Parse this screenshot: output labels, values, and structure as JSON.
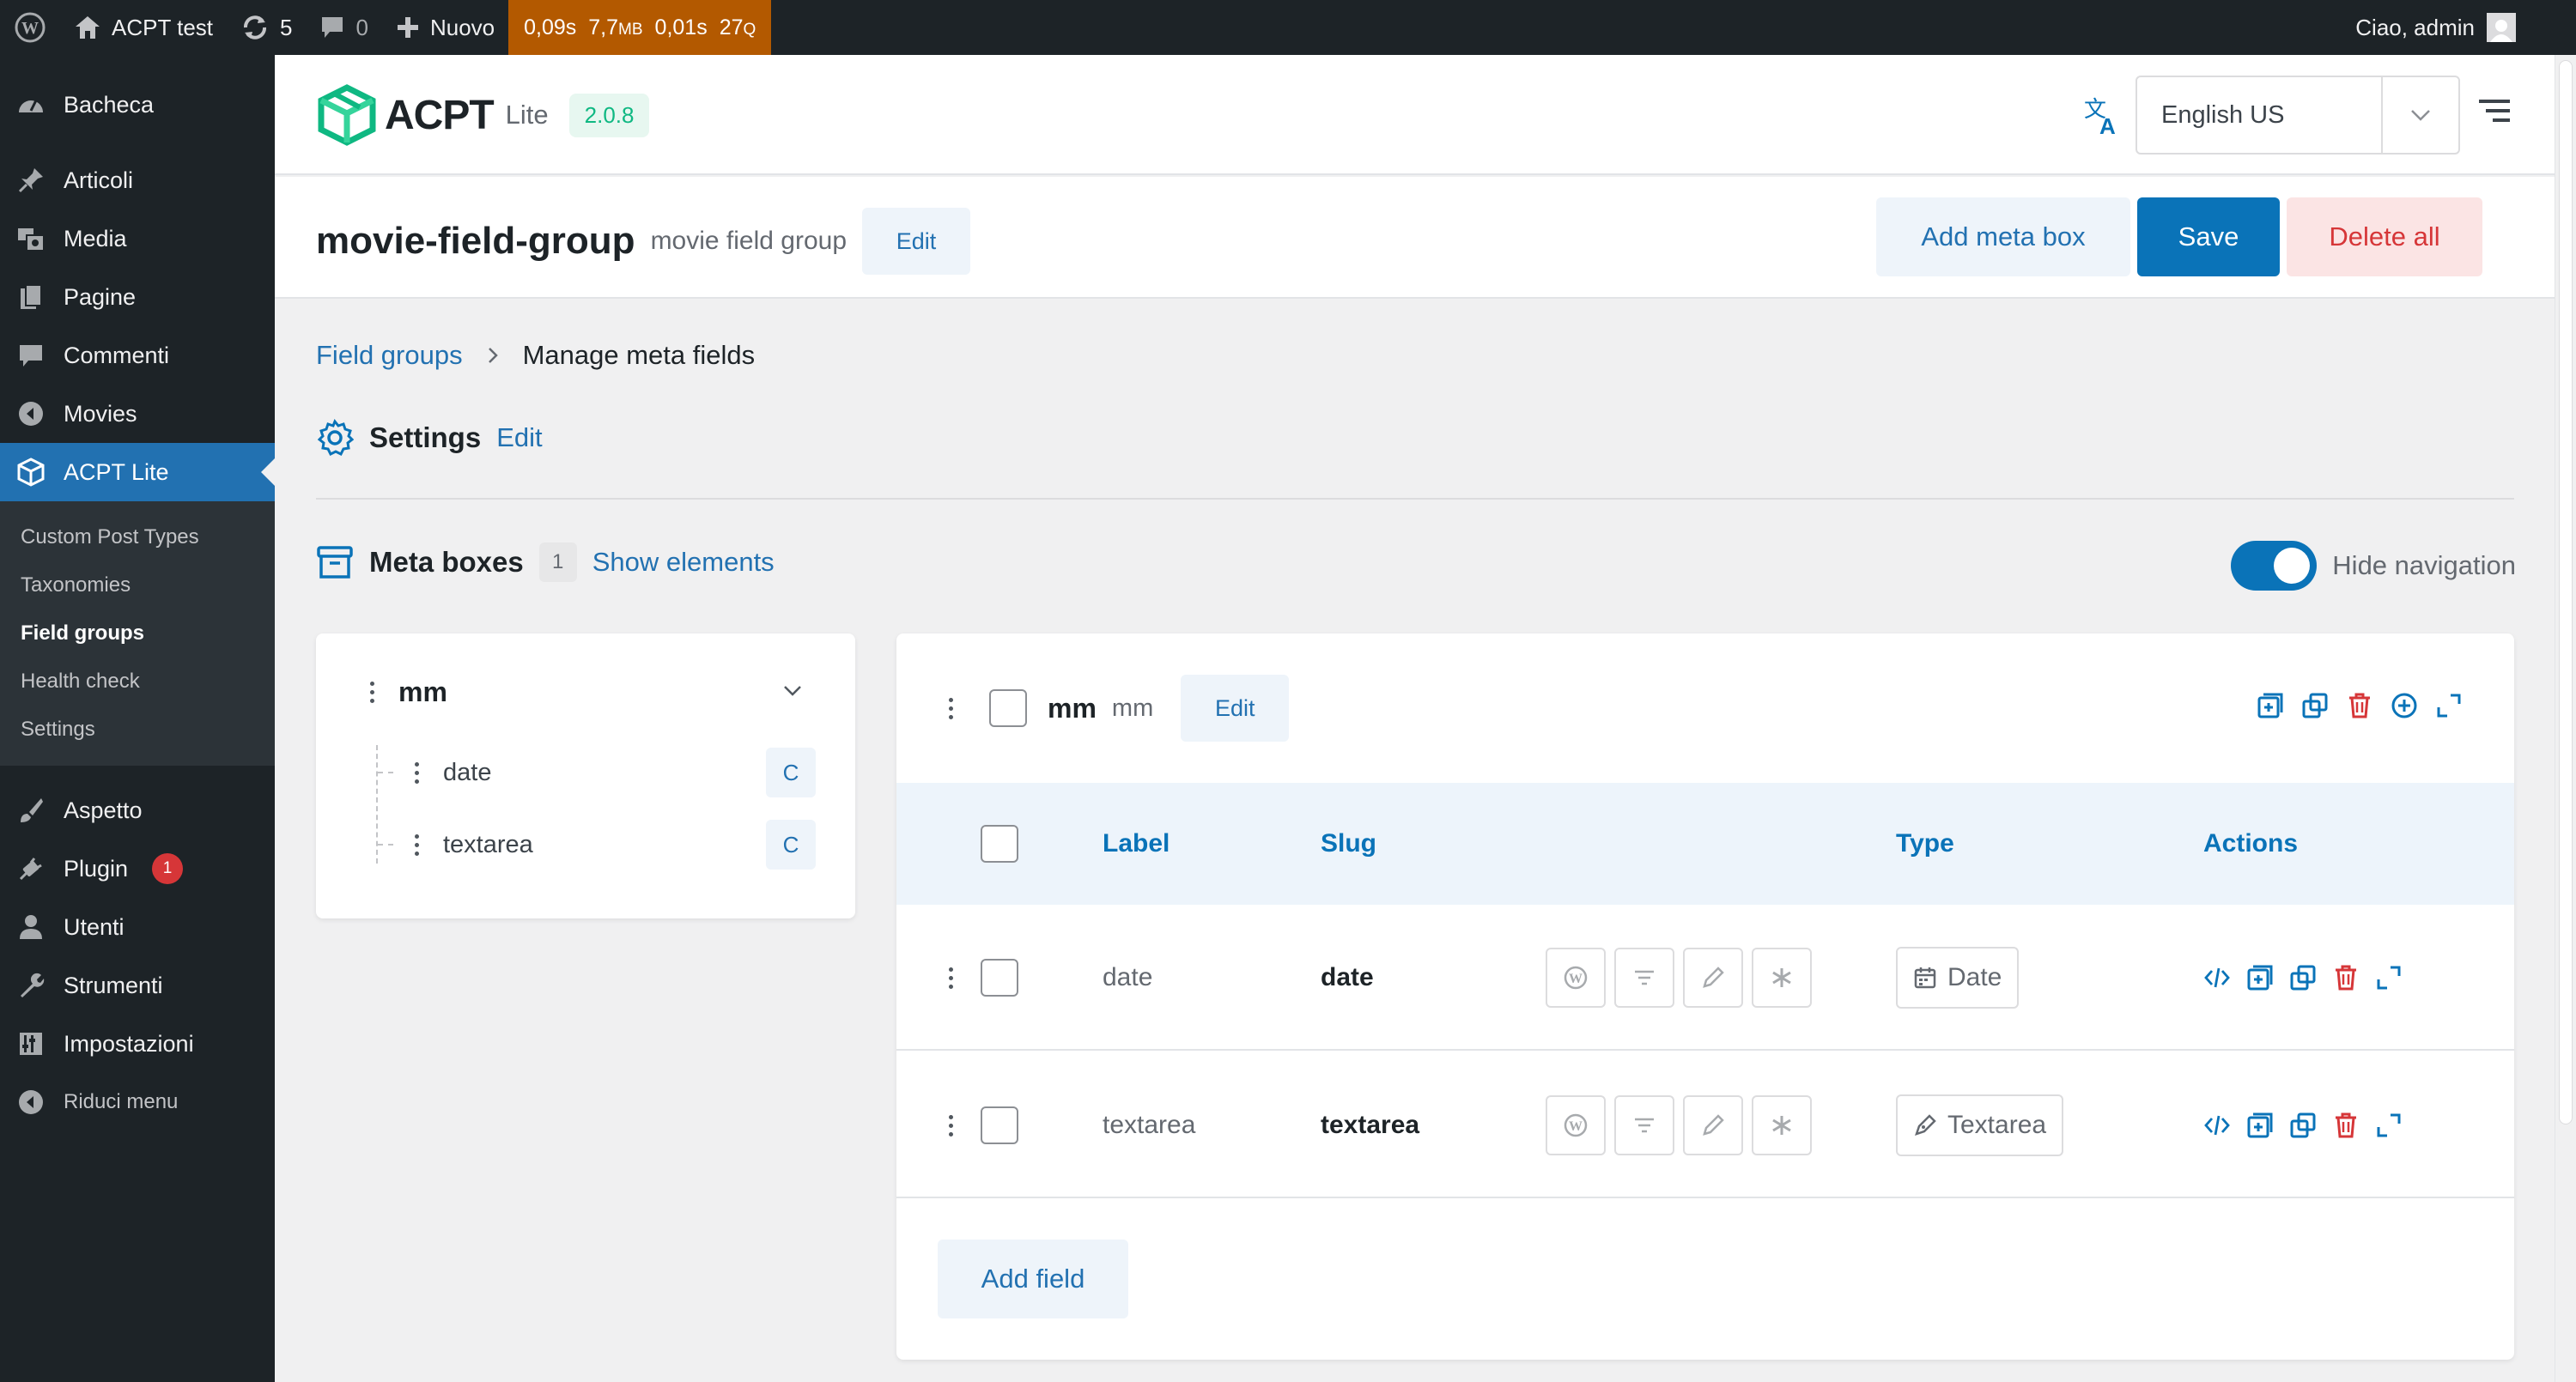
{
  "admin_bar": {
    "site_name": "ACPT test",
    "updates_count": "5",
    "comments_count": "0",
    "new_label": "Nuovo",
    "qm_time": "0,09s",
    "qm_mem": "7,7",
    "qm_mem_unit": "MB",
    "qm_db_time": "0,01s",
    "qm_queries": "27",
    "qm_queries_unit": "Q",
    "greeting": "Ciao, admin"
  },
  "sidebar": {
    "items": [
      {
        "label": "Bacheca",
        "icon": "dashboard-icon"
      },
      {
        "label": "Articoli",
        "icon": "pin-icon"
      },
      {
        "label": "Media",
        "icon": "media-icon"
      },
      {
        "label": "Pagine",
        "icon": "page-icon"
      },
      {
        "label": "Commenti",
        "icon": "comment-icon"
      },
      {
        "label": "Movies",
        "icon": "movie-icon"
      },
      {
        "label": "ACPT Lite",
        "icon": "cube-icon"
      }
    ],
    "submenu": [
      "Custom Post Types",
      "Taxonomies",
      "Field groups",
      "Health check",
      "Settings"
    ],
    "submenu_current": "Field groups",
    "items_after": [
      {
        "label": "Aspetto",
        "icon": "brush-icon"
      },
      {
        "label": "Plugin",
        "icon": "plugin-icon",
        "badge": "1"
      },
      {
        "label": "Utenti",
        "icon": "user-icon"
      },
      {
        "label": "Strumenti",
        "icon": "wrench-icon"
      },
      {
        "label": "Impostazioni",
        "icon": "settings-icon"
      },
      {
        "label": "Riduci menu",
        "icon": "collapse-icon"
      }
    ]
  },
  "header": {
    "brand": "ACPT",
    "edition": "Lite",
    "version": "2.0.8",
    "language": "English US"
  },
  "group": {
    "title": "movie-field-group",
    "subtitle": "movie field group",
    "edit_label": "Edit",
    "add_meta_box": "Add meta box",
    "save": "Save",
    "delete_all": "Delete all"
  },
  "breadcrumb": {
    "parent": "Field groups",
    "current": "Manage meta fields"
  },
  "settings": {
    "title": "Settings",
    "edit": "Edit"
  },
  "meta_boxes": {
    "title": "Meta boxes",
    "count": "1",
    "show_elements": "Show elements",
    "hide_navigation": "Hide navigation",
    "hide_navigation_on": true
  },
  "nav": {
    "box_name": "mm",
    "fields": [
      {
        "name": "date",
        "tag": "C"
      },
      {
        "name": "textarea",
        "tag": "C"
      }
    ]
  },
  "box": {
    "name": "mm",
    "label": "mm",
    "edit": "Edit",
    "columns": {
      "label": "Label",
      "slug": "Slug",
      "type": "Type",
      "actions": "Actions"
    },
    "rows": [
      {
        "label": "date",
        "slug": "date",
        "type": "Date",
        "type_icon": "calendar-icon"
      },
      {
        "label": "textarea",
        "slug": "textarea",
        "type": "Textarea",
        "type_icon": "pen-icon"
      }
    ],
    "add_field": "Add field"
  },
  "colors": {
    "accent": "#0a73b8",
    "brand_green": "#0fb882",
    "danger": "#d63638",
    "admin_dark": "#1d2327",
    "qm_bar": "#b35900"
  }
}
